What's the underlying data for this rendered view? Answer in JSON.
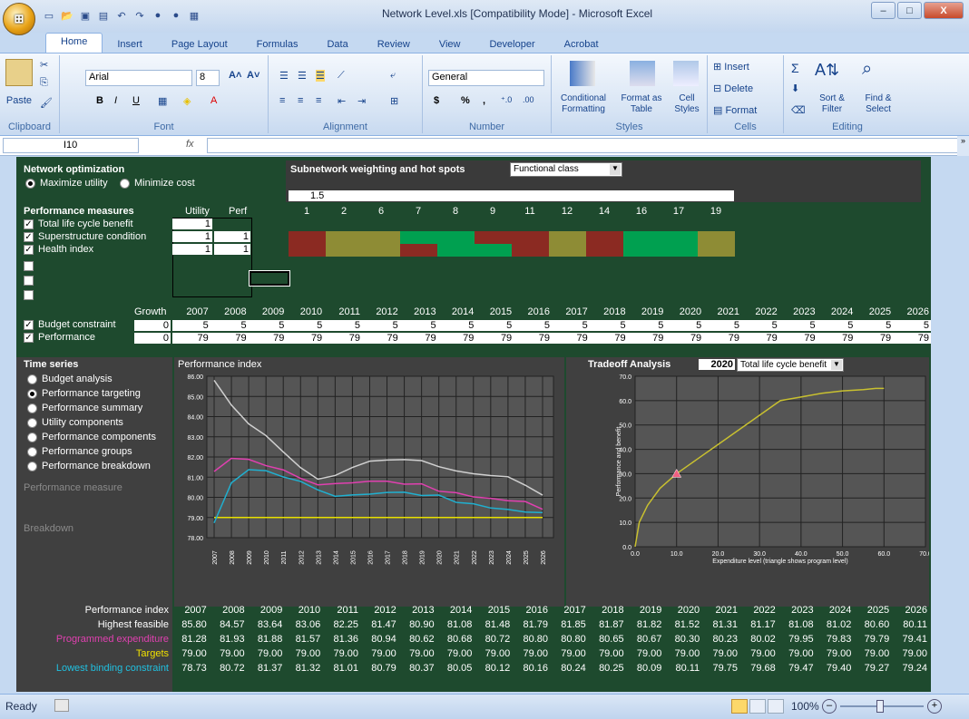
{
  "window": {
    "title": "Network Level.xls [Compatibility Mode] - Microsoft Excel",
    "min": "–",
    "max": "□",
    "close": "X"
  },
  "office_button": "⊞",
  "tabs": [
    "Home",
    "Insert",
    "Page Layout",
    "Formulas",
    "Data",
    "Review",
    "View",
    "Developer",
    "Acrobat"
  ],
  "ribbon": {
    "clipboard": {
      "label": "Clipboard",
      "paste": "Paste"
    },
    "font": {
      "label": "Font",
      "name": "Arial",
      "size": "8",
      "bold": "B",
      "italic": "I",
      "underline": "U"
    },
    "alignment": {
      "label": "Alignment"
    },
    "number": {
      "label": "Number",
      "format": "General",
      "currency": "$",
      "percent": "%",
      "comma": ","
    },
    "styles": {
      "label": "Styles",
      "conditional": "Conditional Formatting",
      "format_table": "Format as Table",
      "cell_styles": "Cell Styles"
    },
    "cells": {
      "label": "Cells",
      "insert": "Insert",
      "delete": "Delete",
      "format": "Format"
    },
    "editing": {
      "label": "Editing",
      "sort": "Sort & Filter",
      "find": "Find & Select",
      "sigma": "Σ"
    }
  },
  "formula_bar": {
    "name_box": "I10",
    "fx": "fx",
    "value": ""
  },
  "sheet": {
    "network_opt": {
      "title": "Network optimization",
      "maximize": "Maximize utility",
      "minimize": "Minimize cost"
    },
    "subnetwork": {
      "title": "Subnetwork weighting and hot spots",
      "dropdown": "Functional class",
      "weight": "1.5",
      "columns": [
        "1",
        "2",
        "6",
        "7",
        "8",
        "9",
        "11",
        "12",
        "14",
        "16",
        "17",
        "19"
      ]
    },
    "perf_measures": {
      "title": "Performance measures",
      "utility": "Utility",
      "perf": "Perf",
      "items": [
        {
          "name": "Total life cycle benefit",
          "utility": "1",
          "perf": ""
        },
        {
          "name": "Superstructure condition",
          "utility": "1",
          "perf": "1"
        },
        {
          "name": "Health index",
          "utility": "1",
          "perf": "1"
        }
      ]
    },
    "growth_label": "Growth",
    "years": [
      "2007",
      "2008",
      "2009",
      "2010",
      "2011",
      "2012",
      "2013",
      "2014",
      "2015",
      "2016",
      "2017",
      "2018",
      "2019",
      "2020",
      "2021",
      "2022",
      "2023",
      "2024",
      "2025",
      "2026"
    ],
    "budget": {
      "label": "Budget constraint",
      "growth": "0",
      "values": [
        "5",
        "5",
        "5",
        "5",
        "5",
        "5",
        "5",
        "5",
        "5",
        "5",
        "5",
        "5",
        "5",
        "5",
        "5",
        "5",
        "5",
        "5",
        "5",
        "5"
      ]
    },
    "performance": {
      "label": "Performance",
      "growth": "0",
      "values": [
        "79",
        "79",
        "79",
        "79",
        "79",
        "79",
        "79",
        "79",
        "79",
        "79",
        "79",
        "79",
        "79",
        "79",
        "79",
        "79",
        "79",
        "79",
        "79",
        "79"
      ]
    },
    "time_series": {
      "title": "Time series",
      "options": [
        "Budget analysis",
        "Performance targeting",
        "Performance summary",
        "Utility components",
        "Performance components",
        "Performance groups",
        "Performance breakdown"
      ],
      "selected": 1,
      "perf_measure": "Performance measure",
      "breakdown": "Breakdown"
    },
    "chart_title": "Performance index",
    "tradeoff": {
      "title": "Tradeoff Analysis",
      "year": "2020",
      "dropdown": "Total life cycle benefit",
      "ylabel": "Performance and benefit",
      "xlabel": "Expenditure level (triangle shows program level)"
    },
    "summary": {
      "header": "Performance index",
      "rows": [
        {
          "label": "Highest feasible",
          "color": "#ffffff",
          "values": [
            "85.80",
            "84.57",
            "83.64",
            "83.06",
            "82.25",
            "81.47",
            "80.90",
            "81.08",
            "81.48",
            "81.79",
            "81.85",
            "81.87",
            "81.82",
            "81.52",
            "81.31",
            "81.17",
            "81.08",
            "81.02",
            "80.60",
            "80.11"
          ]
        },
        {
          "label": "Programmed expenditure",
          "color": "#e040b0",
          "values": [
            "81.28",
            "81.93",
            "81.88",
            "81.57",
            "81.36",
            "80.94",
            "80.62",
            "80.68",
            "80.72",
            "80.80",
            "80.80",
            "80.65",
            "80.67",
            "80.30",
            "80.23",
            "80.02",
            "79.95",
            "79.83",
            "79.79",
            "79.41"
          ]
        },
        {
          "label": "Targets",
          "color": "#f0e000",
          "values": [
            "79.00",
            "79.00",
            "79.00",
            "79.00",
            "79.00",
            "79.00",
            "79.00",
            "79.00",
            "79.00",
            "79.00",
            "79.00",
            "79.00",
            "79.00",
            "79.00",
            "79.00",
            "79.00",
            "79.00",
            "79.00",
            "79.00",
            "79.00"
          ]
        },
        {
          "label": "Lowest binding constraint",
          "color": "#20c0e0",
          "values": [
            "78.73",
            "80.72",
            "81.37",
            "81.32",
            "81.01",
            "80.79",
            "80.37",
            "80.05",
            "80.12",
            "80.16",
            "80.24",
            "80.25",
            "80.09",
            "80.11",
            "79.75",
            "79.68",
            "79.47",
            "79.40",
            "79.27",
            "79.24"
          ]
        }
      ]
    }
  },
  "status": {
    "ready": "Ready",
    "zoom": "100%"
  },
  "chart_data": [
    {
      "type": "line",
      "title": "Performance index",
      "x": [
        "2007",
        "2008",
        "2009",
        "2010",
        "2011",
        "2012",
        "2013",
        "2014",
        "2015",
        "2016",
        "2017",
        "2018",
        "2019",
        "2020",
        "2021",
        "2022",
        "2023",
        "2024",
        "2025",
        "2026"
      ],
      "ylim": [
        78,
        86
      ],
      "yticks": [
        "86.00",
        "85.00",
        "84.00",
        "83.00",
        "82.00",
        "81.00",
        "80.00",
        "79.00",
        "78.00"
      ],
      "series": [
        {
          "name": "Highest feasible",
          "color": "#d0d0d0",
          "values": [
            85.8,
            84.57,
            83.64,
            83.06,
            82.25,
            81.47,
            80.9,
            81.08,
            81.48,
            81.79,
            81.85,
            81.87,
            81.82,
            81.52,
            81.31,
            81.17,
            81.08,
            81.02,
            80.6,
            80.11
          ]
        },
        {
          "name": "Programmed expenditure",
          "color": "#e040b0",
          "values": [
            81.28,
            81.93,
            81.88,
            81.57,
            81.36,
            80.94,
            80.62,
            80.68,
            80.72,
            80.8,
            80.8,
            80.65,
            80.67,
            80.3,
            80.23,
            80.02,
            79.95,
            79.83,
            79.79,
            79.41
          ]
        },
        {
          "name": "Targets",
          "color": "#e8e000",
          "values": [
            79,
            79,
            79,
            79,
            79,
            79,
            79,
            79,
            79,
            79,
            79,
            79,
            79,
            79,
            79,
            79,
            79,
            79,
            79,
            79
          ]
        },
        {
          "name": "Lowest binding constraint",
          "color": "#20b0d0",
          "values": [
            78.73,
            80.72,
            81.37,
            81.32,
            81.01,
            80.79,
            80.37,
            80.05,
            80.12,
            80.16,
            80.24,
            80.25,
            80.09,
            80.11,
            79.75,
            79.68,
            79.47,
            79.4,
            79.27,
            79.24
          ]
        }
      ]
    },
    {
      "type": "line",
      "title": "",
      "xlabel": "Expenditure level (triangle shows program level)",
      "ylabel": "Performance and benefit",
      "xlim": [
        0,
        70
      ],
      "ylim": [
        0,
        70
      ],
      "xticks": [
        "0.0",
        "10.0",
        "20.0",
        "30.0",
        "40.0",
        "50.0",
        "60.0",
        "70.0"
      ],
      "yticks": [
        "70.0",
        "60.0",
        "50.0",
        "40.0",
        "30.0",
        "20.0",
        "10.0",
        "0.0"
      ],
      "series": [
        {
          "color": "#c8c030",
          "x": [
            0,
            1,
            3,
            6,
            10,
            15,
            20,
            25,
            30,
            35,
            40,
            45,
            50,
            55,
            58,
            60
          ],
          "values": [
            0,
            10,
            17,
            24,
            30,
            36,
            42,
            48,
            54,
            60,
            61.5,
            63,
            64,
            64.5,
            65,
            65
          ]
        }
      ],
      "marker": {
        "x": 10,
        "y": 30
      }
    }
  ]
}
